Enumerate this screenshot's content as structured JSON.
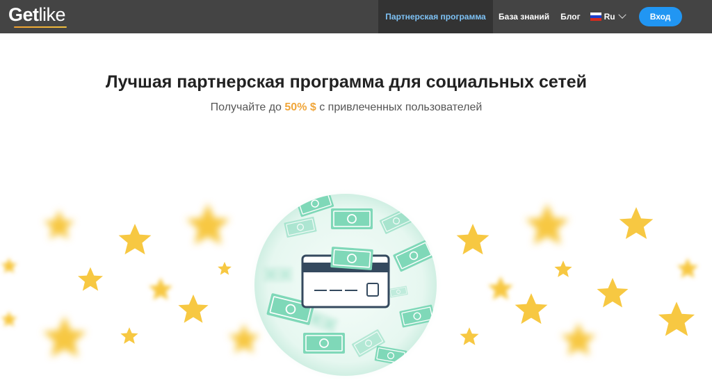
{
  "brand": {
    "logo_bold": "Get",
    "logo_light": "like",
    "accent": "#f0a63a"
  },
  "nav": {
    "items": [
      {
        "label": "Партнерская программа",
        "active": true
      },
      {
        "label": "База знаний",
        "active": false
      },
      {
        "label": "Блог",
        "active": false
      }
    ],
    "language": {
      "label": "Ru",
      "icon": "flag-ru-icon"
    },
    "login_label": "Вход"
  },
  "hero": {
    "title": "Лучшая партнерская программа для социальных сетей",
    "subtitle_before": "Получайте до",
    "subtitle_accent": "50% $",
    "subtitle_after": "с привлеченных пользователей"
  },
  "illustration": {
    "icon": "credit-card-with-money-icon",
    "decoration": "stars-icon",
    "colors": {
      "star": "#f7c842",
      "money": "#7fd8b8",
      "card": "#34495e"
    }
  }
}
